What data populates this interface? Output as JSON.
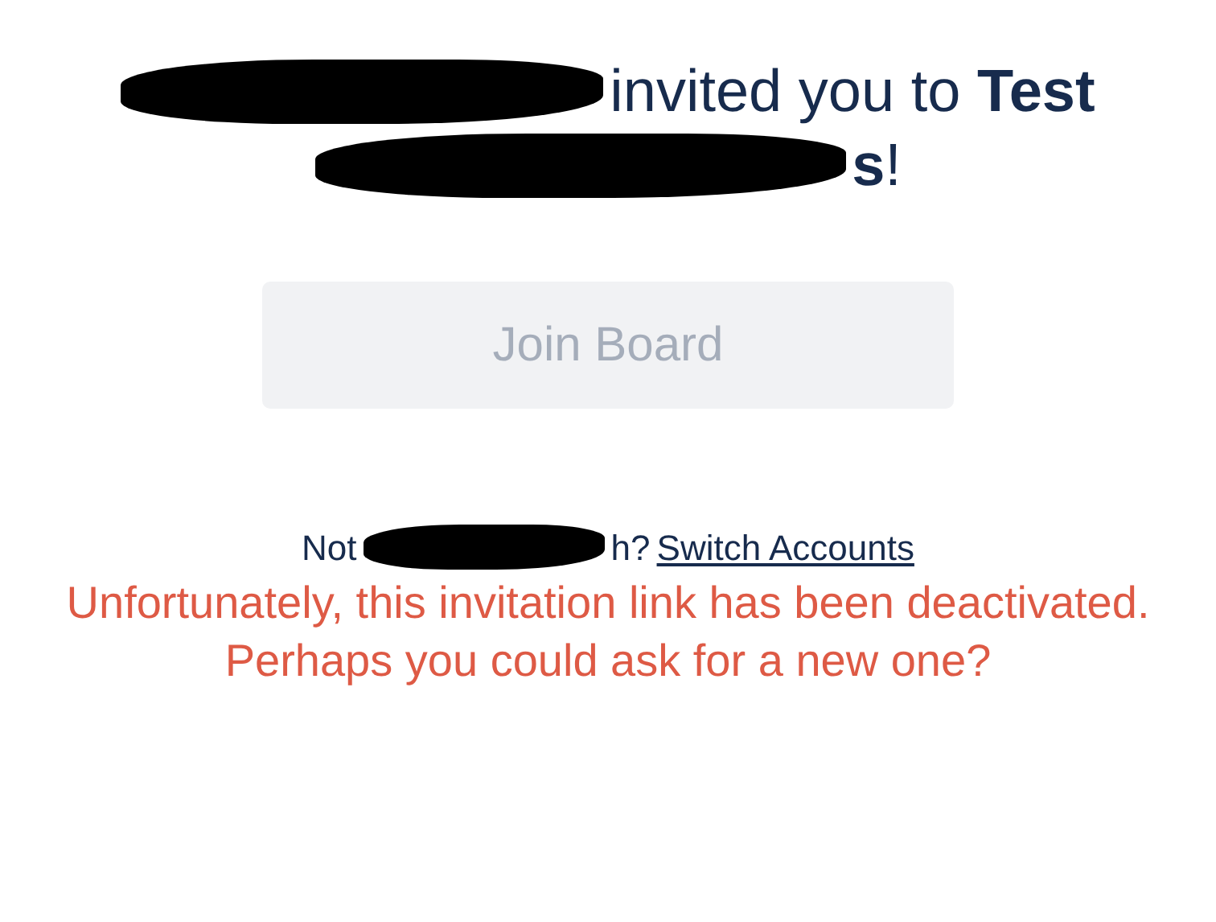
{
  "heading": {
    "lines": [
      {
        "redacted": true,
        "text": "invited you to **Test**"
      },
      {
        "redacted": true,
        "text": "**s**!"
      }
    ]
  },
  "join_button": {
    "label": "Join Board",
    "disabled": true
  },
  "account_prompt": {
    "prefix": "Not",
    "redacted": true,
    "suffix": "h?",
    "link": "Switch Accounts"
  },
  "error_message": "Unfortunately, this invitation link has been deactivated. Perhaps you could ask for a new one?"
}
